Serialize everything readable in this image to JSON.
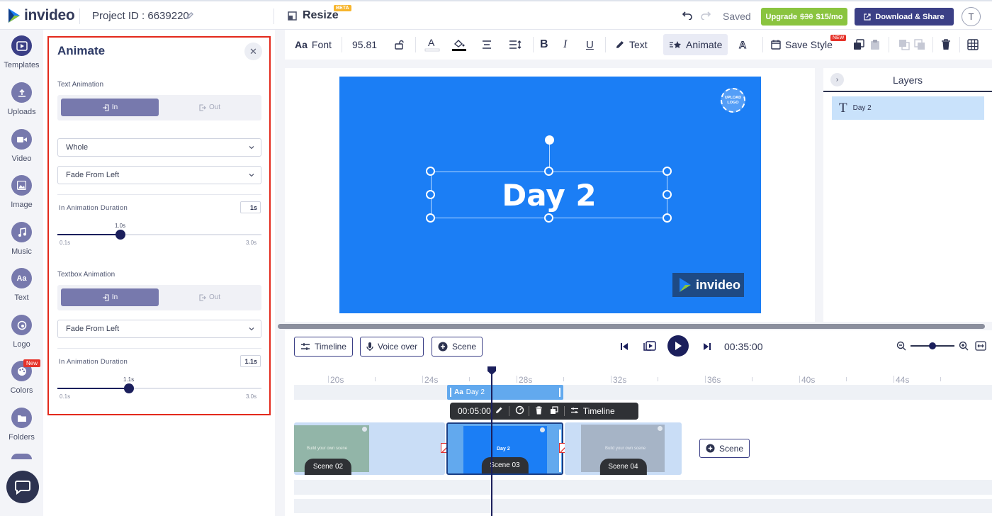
{
  "header": {
    "brand": "invideo",
    "project_id": "Project ID : 6639220",
    "resize_label": "Resize",
    "beta_badge": "BETA",
    "saved_status": "Saved",
    "upgrade_label": "Upgrade",
    "upgrade_old_price": "$30",
    "upgrade_new_price": "$15/mo",
    "download_label": "Download & Share",
    "avatar_letter": "T"
  },
  "sidebar": {
    "items": [
      {
        "label": "Templates",
        "icon": "video-play-icon"
      },
      {
        "label": "Uploads",
        "icon": "upload-icon"
      },
      {
        "label": "Video",
        "icon": "camera-icon"
      },
      {
        "label": "Image",
        "icon": "image-icon"
      },
      {
        "label": "Music",
        "icon": "music-note-icon"
      },
      {
        "label": "Text",
        "icon": "text-aa-icon"
      },
      {
        "label": "Logo",
        "icon": "logo-icon"
      },
      {
        "label": "Colors",
        "icon": "palette-icon"
      },
      {
        "label": "Folders",
        "icon": "folder-icon"
      }
    ],
    "new_badge": "New"
  },
  "panel": {
    "title": "Animate",
    "text_animation": {
      "label": "Text Animation",
      "in_label": "In",
      "out_label": "Out",
      "scope_value": "Whole",
      "effect_value": "Fade From Left",
      "duration_label": "In Animation Duration",
      "duration_box": "1s",
      "slider_value": "1.0s",
      "slider_min": "0.1s",
      "slider_max": "3.0s",
      "slider_fraction": 0.31
    },
    "textbox_animation": {
      "label": "Textbox Animation",
      "in_label": "In",
      "out_label": "Out",
      "effect_value": "Fade From Left",
      "duration_label": "In Animation Duration",
      "duration_box": "1.1s",
      "slider_value": "1.1s",
      "slider_min": "0.1s",
      "slider_max": "3.0s",
      "slider_fraction": 0.35
    }
  },
  "toolbar": {
    "font_label": "Font",
    "font_prefix": "Aa",
    "font_size": "95.81",
    "text_label": "Text",
    "animate_label": "Animate",
    "save_style_label": "Save Style",
    "new_badge": "NEW"
  },
  "canvas": {
    "upload_logo_line1": "UPLOAD",
    "upload_logo_line2": "LOGO",
    "headline": "Day 2",
    "watermark": "invideo",
    "bg_color": "#1b7ef5"
  },
  "layers": {
    "title": "Layers",
    "items": [
      {
        "label": "Day 2"
      }
    ]
  },
  "timeline": {
    "timeline_label": "Timeline",
    "voiceover_label": "Voice over",
    "scene_label": "Scene",
    "current_time": "00:35:00",
    "ruler": [
      "20s",
      "24s",
      "28s",
      "32s",
      "36s",
      "40s",
      "44s"
    ],
    "text_clip_label": "Day 2",
    "text_clip_prefix": "Aa",
    "clip_duration": "00:05:00",
    "clip_timeline_label": "Timeline",
    "scenes": [
      {
        "label": "Scene 02",
        "thumb_text": "Build your own scene"
      },
      {
        "label": "Scene 03",
        "thumb_text": "Day 2"
      },
      {
        "label": "Scene 04",
        "thumb_text": "Build your own scene"
      }
    ],
    "add_scene_label": "Scene"
  }
}
